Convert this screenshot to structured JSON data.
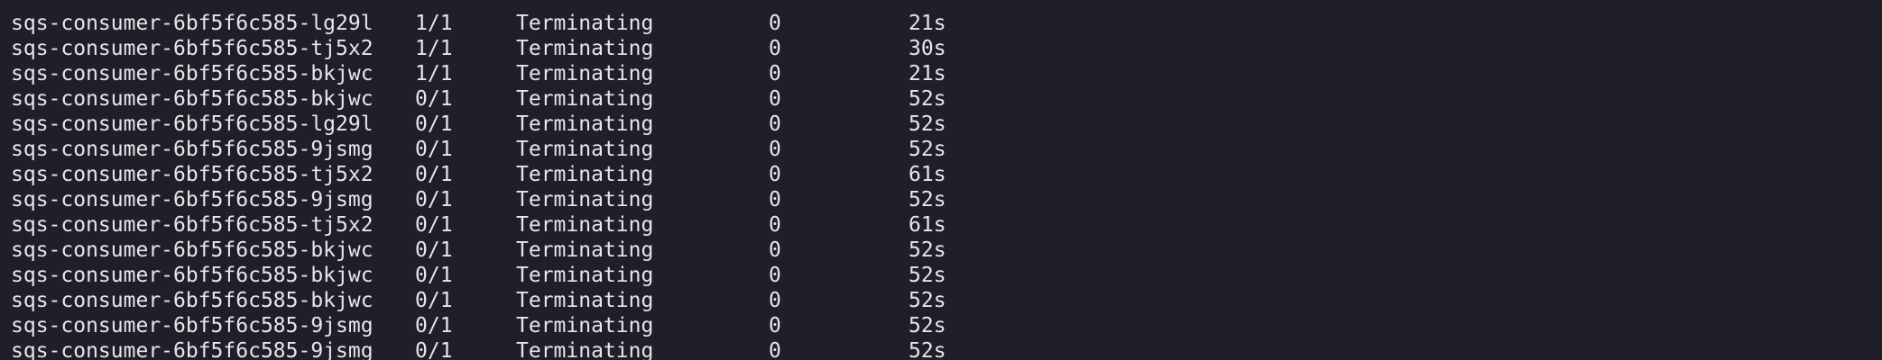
{
  "terminal": {
    "rows": [
      {
        "name": "sqs-consumer-6bf5f6c585-lg29l",
        "ready": "1/1",
        "status": "Terminating",
        "restarts": "0",
        "age": "21s"
      },
      {
        "name": "sqs-consumer-6bf5f6c585-tj5x2",
        "ready": "1/1",
        "status": "Terminating",
        "restarts": "0",
        "age": "30s"
      },
      {
        "name": "sqs-consumer-6bf5f6c585-bkjwc",
        "ready": "1/1",
        "status": "Terminating",
        "restarts": "0",
        "age": "21s"
      },
      {
        "name": "sqs-consumer-6bf5f6c585-bkjwc",
        "ready": "0/1",
        "status": "Terminating",
        "restarts": "0",
        "age": "52s"
      },
      {
        "name": "sqs-consumer-6bf5f6c585-lg29l",
        "ready": "0/1",
        "status": "Terminating",
        "restarts": "0",
        "age": "52s"
      },
      {
        "name": "sqs-consumer-6bf5f6c585-9jsmg",
        "ready": "0/1",
        "status": "Terminating",
        "restarts": "0",
        "age": "52s"
      },
      {
        "name": "sqs-consumer-6bf5f6c585-tj5x2",
        "ready": "0/1",
        "status": "Terminating",
        "restarts": "0",
        "age": "61s"
      },
      {
        "name": "sqs-consumer-6bf5f6c585-9jsmg",
        "ready": "0/1",
        "status": "Terminating",
        "restarts": "0",
        "age": "52s"
      },
      {
        "name": "sqs-consumer-6bf5f6c585-tj5x2",
        "ready": "0/1",
        "status": "Terminating",
        "restarts": "0",
        "age": "61s"
      },
      {
        "name": "sqs-consumer-6bf5f6c585-bkjwc",
        "ready": "0/1",
        "status": "Terminating",
        "restarts": "0",
        "age": "52s"
      },
      {
        "name": "sqs-consumer-6bf5f6c585-bkjwc",
        "ready": "0/1",
        "status": "Terminating",
        "restarts": "0",
        "age": "52s"
      },
      {
        "name": "sqs-consumer-6bf5f6c585-bkjwc",
        "ready": "0/1",
        "status": "Terminating",
        "restarts": "0",
        "age": "52s"
      },
      {
        "name": "sqs-consumer-6bf5f6c585-9jsmg",
        "ready": "0/1",
        "status": "Terminating",
        "restarts": "0",
        "age": "52s"
      },
      {
        "name": "sqs-consumer-6bf5f6c585-9jsmg",
        "ready": "0/1",
        "status": "Terminating",
        "restarts": "0",
        "age": "52s"
      }
    ]
  },
  "colors": {
    "background": "#1f1f29",
    "text": "#e6e6ea"
  }
}
